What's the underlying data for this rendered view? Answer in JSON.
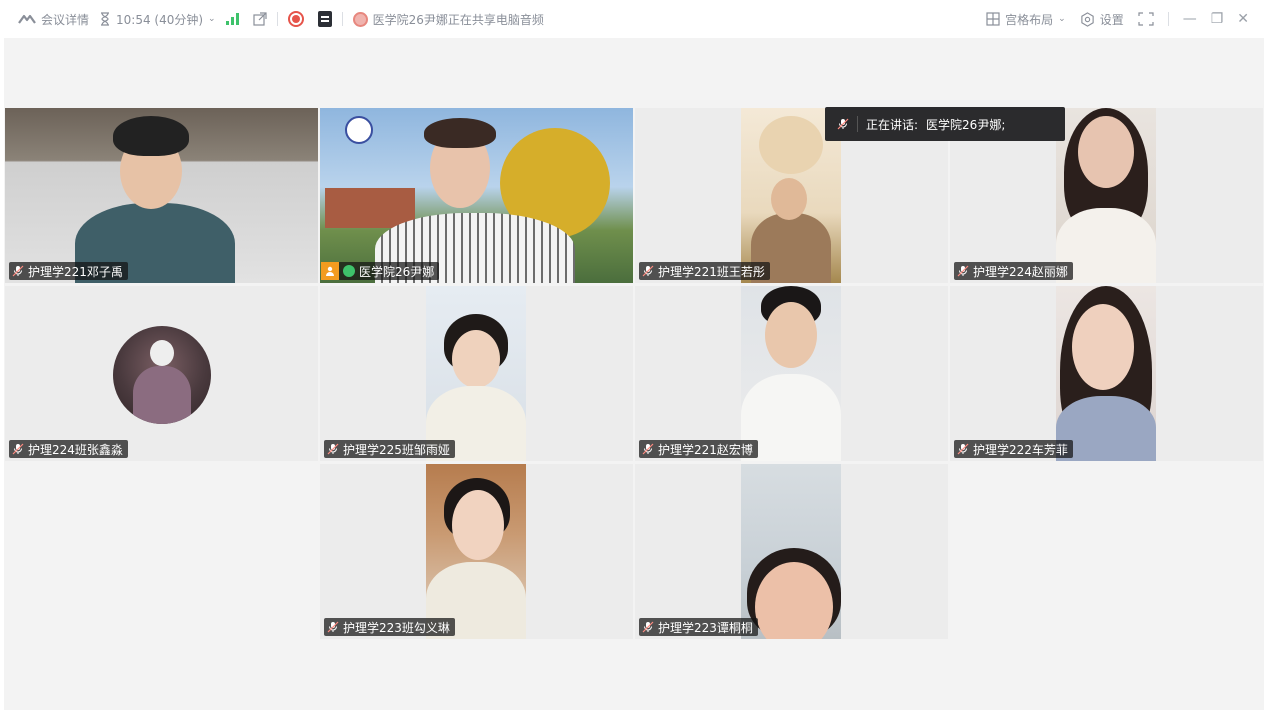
{
  "topbar": {
    "meeting_details": "会议详情",
    "timer": "10:54 (40分钟)",
    "sharing_text": "医学院26尹娜正在共享电脑音频",
    "layout_label": "宫格布局",
    "settings_label": "设置"
  },
  "speaking": {
    "label": "正在讲话:",
    "name": "医学院26尹娜;"
  },
  "participants": [
    {
      "name": "护理学221邓子禹"
    },
    {
      "name": "医学院26尹娜"
    },
    {
      "name": "护理学221班王若彤"
    },
    {
      "name": "护理学224赵丽娜"
    },
    {
      "name": "护理224班张鑫淼"
    },
    {
      "name": "护理学225班邹雨娅"
    },
    {
      "name": "护理学221赵宏博"
    },
    {
      "name": "护理学222车芳菲"
    },
    {
      "name": "护理学223班勾义琳"
    },
    {
      "name": "护理学223谭桐桐"
    }
  ],
  "colors": {
    "active_border": "#2fc27b",
    "host_badge": "#f39c1f",
    "record": "#e6544a"
  }
}
